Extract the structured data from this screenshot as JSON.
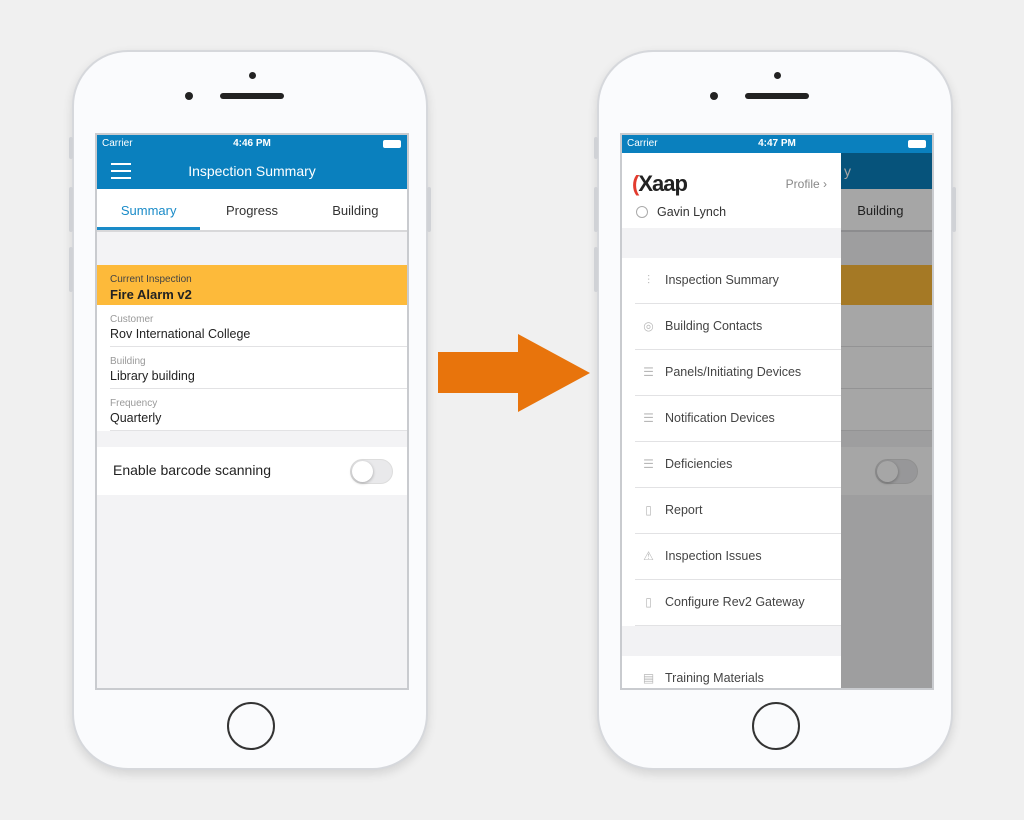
{
  "left_phone": {
    "status": {
      "carrier": "Carrier",
      "time": "4:46 PM"
    },
    "nav": {
      "title": "Inspection Summary",
      "menu_icon": "hamburger-icon"
    },
    "tabs": [
      {
        "label": "Summary",
        "active": true
      },
      {
        "label": "Progress"
      },
      {
        "label": "Building"
      }
    ],
    "current_inspection": {
      "label": "Current Inspection",
      "value": "Fire Alarm v2"
    },
    "fields": [
      {
        "label": "Customer",
        "value": "Rov International College"
      },
      {
        "label": "Building",
        "value": "Library building"
      },
      {
        "label": "Frequency",
        "value": "Quarterly"
      }
    ],
    "barcode": {
      "label": "Enable barcode scanning",
      "enabled": false
    }
  },
  "right_phone": {
    "status": {
      "carrier": "Carrier",
      "time": "4:47 PM"
    },
    "background_title_fragment": "y",
    "background_tab": "Building",
    "drawer": {
      "logo": "Xaap",
      "profile_label": "Profile",
      "user_name": "Gavin Lynch",
      "items": [
        {
          "label": "Inspection Summary",
          "icon": "sliders-icon"
        },
        {
          "label": "Building Contacts",
          "icon": "contacts-icon"
        },
        {
          "label": "Panels/Initiating Devices",
          "icon": "checklist-icon"
        },
        {
          "label": "Notification Devices",
          "icon": "checklist-icon"
        },
        {
          "label": "Deficiencies",
          "icon": "checklist-icon"
        },
        {
          "label": "Report",
          "icon": "bar-chart-icon"
        },
        {
          "label": "Inspection Issues",
          "icon": "warning-icon"
        },
        {
          "label": "Configure Rev2 Gateway",
          "icon": "tablet-icon"
        }
      ],
      "secondary_items": [
        {
          "label": "Training Materials",
          "icon": "book-icon"
        }
      ]
    }
  },
  "colors": {
    "primary": "#0A80BE",
    "highlight": "#FDBA3A",
    "arrow": "#E8740C",
    "tab_active": "#1A8BC8"
  }
}
